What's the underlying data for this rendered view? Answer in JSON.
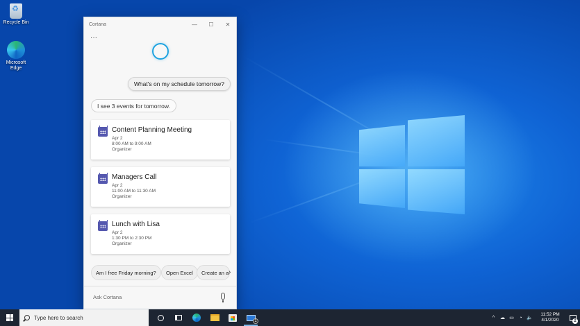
{
  "desktop": {
    "icons": [
      {
        "label": "Recycle Bin",
        "icon": "recycle-bin-icon"
      },
      {
        "label": "Microsoft Edge",
        "icon": "edge-icon"
      }
    ]
  },
  "cortana": {
    "title": "Cortana",
    "controls": {
      "minimize": "—",
      "maximize": "☐",
      "close": "✕"
    },
    "more_label": "···",
    "user_message": "What's on my schedule tomorrow?",
    "reply": "I see 3 events for tomorrow.",
    "events": [
      {
        "title": "Content Planning Meeting",
        "date": "Apr 2",
        "time": "8:00 AM to 9:00 AM",
        "role": "Organizer"
      },
      {
        "title": "Managers Call",
        "date": "Apr 2",
        "time": "11:00 AM to 11:30 AM",
        "role": "Organizer"
      },
      {
        "title": "Lunch with Lisa",
        "date": "Apr 2",
        "time": "1:30 PM to 2:30 PM",
        "role": "Organizer"
      }
    ],
    "suggestions": [
      "Am I free Friday morning?",
      "Open Excel",
      "Create an ap"
    ],
    "suggestions_next": "›",
    "ask_placeholder": "Ask Cortana"
  },
  "taskbar": {
    "search_placeholder": "Type here to search",
    "mail_badge": "1",
    "tray_icons": [
      "^",
      "☁",
      "▭",
      "◔",
      "🔈"
    ],
    "time": "11:52 PM",
    "date": "4/1/2020",
    "notification_count": "2"
  }
}
